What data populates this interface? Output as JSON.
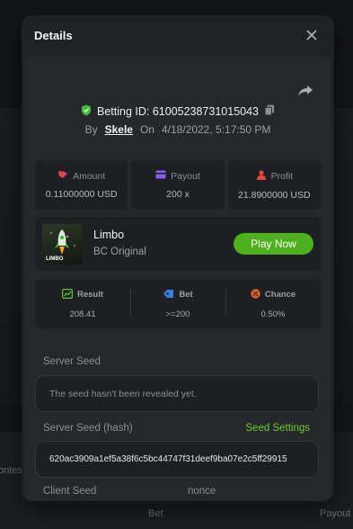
{
  "background": {
    "bottom_labels": [
      "ontes",
      "Bet",
      "Payout"
    ]
  },
  "modal": {
    "title": "Details",
    "close_icon": "close-icon"
  },
  "bet": {
    "id_text": "Betting ID: 61005238731015043",
    "by_label": "By",
    "username": "Skele",
    "on_label": "On",
    "date": "4/18/2022, 5:17:50 PM"
  },
  "stats": [
    {
      "label": "Amount",
      "value": "0.11000000 USD",
      "icon": "amount-icon",
      "color": "#e0435b"
    },
    {
      "label": "Payout",
      "value": "200 x",
      "icon": "payout-icon",
      "color": "#8c5cf0"
    },
    {
      "label": "Profit",
      "value": "21.8900000 USD",
      "icon": "profit-icon",
      "color": "#e04a3a"
    }
  ],
  "game": {
    "thumb_text": "LIMBO",
    "name": "Limbo",
    "provider": "BC Original",
    "play_label": "Play Now"
  },
  "results": [
    {
      "label": "Result",
      "value": "208.41",
      "icon": "chart-icon",
      "color": "#5fc72b"
    },
    {
      "label": "Bet",
      "value": ">=200",
      "icon": "tag-icon",
      "color": "#3c7ce0"
    },
    {
      "label": "Chance",
      "value": "0.50%",
      "icon": "percent-icon",
      "color": "#e0622b"
    }
  ],
  "seeds": {
    "server_seed_label": "Server Seed",
    "server_seed_placeholder": "The seed hasn't been revealed yet.",
    "server_hash_label": "Server Seed (hash)",
    "seed_settings_label": "Seed Settings",
    "server_hash_value": "620ac3909a1ef5a38f6c5bc44747f31deef9ba07e2c5ff29915",
    "client_seed_label": "Client Seed",
    "nonce_label": "nonce"
  },
  "colors": {
    "accent_green": "#4fb01d",
    "link_green": "#6bd02e",
    "verified_green": "#3fbf35"
  }
}
